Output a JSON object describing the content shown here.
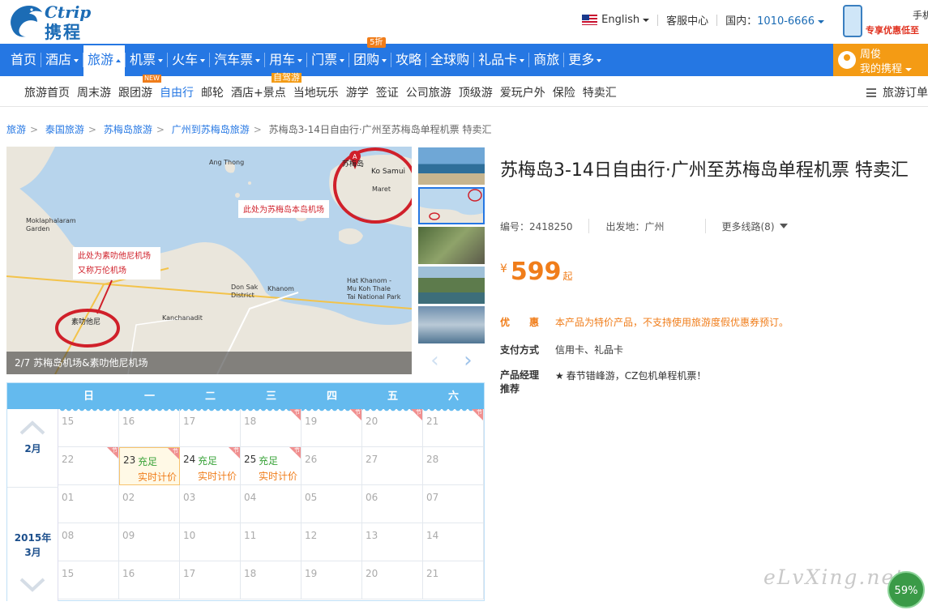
{
  "header": {
    "brand": "Ctrip",
    "brand_cn": "携程",
    "language": "English",
    "service": "客服中心",
    "phone_label": "国内：",
    "phone": "1010-6666",
    "mobile_title": "手机",
    "mobile_promo": "专享优惠低至"
  },
  "nav": {
    "items": [
      {
        "label": "首页",
        "caret": false
      },
      {
        "label": "酒店",
        "caret": true
      },
      {
        "label": "旅游",
        "caret": true,
        "active": true
      },
      {
        "label": "机票",
        "caret": true
      },
      {
        "label": "火车",
        "caret": true
      },
      {
        "label": "汽车票",
        "caret": true
      },
      {
        "label": "用车",
        "caret": true
      },
      {
        "label": "门票",
        "caret": true
      },
      {
        "label": "团购",
        "caret": true,
        "badge": "5折"
      },
      {
        "label": "攻略",
        "caret": false
      },
      {
        "label": "全球购",
        "caret": false
      },
      {
        "label": "礼品卡",
        "caret": true
      },
      {
        "label": "商旅",
        "caret": false
      },
      {
        "label": "更多",
        "caret": true
      }
    ],
    "user_name": "周俊",
    "user_menu": "我的携程"
  },
  "subnav": {
    "items": [
      "旅游首页",
      "周末游",
      "跟团游",
      "自由行",
      "邮轮",
      "酒店+景点",
      "当地玩乐",
      "游学",
      "签证",
      "公司旅游",
      "顶级游",
      "爱玩户外",
      "保险",
      "特卖汇"
    ],
    "active": "自由行",
    "new_badge": "NEW",
    "zjy_badge": "自驾游",
    "order": "旅游订单"
  },
  "breadcrumb": {
    "links": [
      "旅游",
      "泰国旅游",
      "苏梅岛旅游",
      "广州到苏梅岛旅游"
    ],
    "current": "苏梅岛3-14日自由行·广州至苏梅岛单程机票 特卖汇"
  },
  "gallery": {
    "caption": "2/7 苏梅岛机场&素叻他尼机场",
    "map_labels": {
      "samui": "苏梅岛",
      "samui_en": "Ko Samui",
      "airport_note": "此处为苏梅岛本岛机场",
      "surat_note_1": "此处为素叻他尼机场",
      "surat_note_2": "又称万伦机场",
      "surat": "素叻他尼",
      "ang_thong": "Ang Thong",
      "moklaphalaram": "Moklaphalaram",
      "garden": "Garden",
      "don_sak": "Don Sak",
      "district": "District",
      "khanom": "Khanom",
      "kanchanadit": "Kanchanadit",
      "hat_khanom": "Hat Khanom -",
      "mu_koh": "Mu Koh Thale",
      "tai_np": "Tai National Park",
      "maret": "Maret"
    },
    "prev_glyph": "‹",
    "next_glyph": "›"
  },
  "product": {
    "title": "苏梅岛3-14日自由行·广州至苏梅岛单程机票 特卖汇",
    "id_label": "编号：",
    "id": "2418250",
    "depart_label": "出发地：",
    "depart": "广州",
    "more_routes": "更多线路(8)",
    "currency": "¥",
    "price": "599",
    "price_suffix": "起",
    "discount_label": "优　　惠",
    "discount_text": "本产品为特价产品，不支持使用旅游度假优惠券预订。",
    "payment_label": "支付方式",
    "payment": "信用卡、礼品卡",
    "manager_label_1": "产品经理",
    "manager_label_2": "推荐",
    "manager_text": "春节错峰游，CZ包机单程机票！",
    "colors": {
      "accent": "#2577e3",
      "price": "#f07d1a",
      "user": "#f49b14"
    }
  },
  "calendar": {
    "weekdays": [
      "日",
      "一",
      "二",
      "三",
      "四",
      "五",
      "六"
    ],
    "months": [
      {
        "label": "2月"
      },
      {
        "label_1": "2015年",
        "label_2": "3月"
      }
    ],
    "rows": [
      [
        {
          "d": "15"
        },
        {
          "d": "16"
        },
        {
          "d": "17"
        },
        {
          "d": "18",
          "tag": true
        },
        {
          "d": "19",
          "tag": true
        },
        {
          "d": "20",
          "tag": true
        },
        {
          "d": "21",
          "tag": true
        }
      ],
      [
        {
          "d": "22",
          "tag": true
        },
        {
          "d": "23",
          "status": "充足",
          "price": "实时计价",
          "tag": true,
          "selected": true
        },
        {
          "d": "24",
          "status": "充足",
          "price": "实时计价",
          "tag": true
        },
        {
          "d": "25",
          "status": "充足",
          "price": "实时计价",
          "tag": true
        },
        {
          "d": "26"
        },
        {
          "d": "27"
        },
        {
          "d": "28"
        }
      ],
      [
        {
          "d": "01"
        },
        {
          "d": "02"
        },
        {
          "d": "03"
        },
        {
          "d": "04"
        },
        {
          "d": "05"
        },
        {
          "d": "06"
        },
        {
          "d": "07"
        }
      ],
      [
        {
          "d": "08"
        },
        {
          "d": "09"
        },
        {
          "d": "10"
        },
        {
          "d": "11"
        },
        {
          "d": "12"
        },
        {
          "d": "13"
        },
        {
          "d": "14"
        }
      ],
      [
        {
          "d": "15"
        },
        {
          "d": "16"
        },
        {
          "d": "17"
        },
        {
          "d": "18"
        },
        {
          "d": "19"
        },
        {
          "d": "20"
        },
        {
          "d": "21"
        }
      ]
    ],
    "tag_text": "节"
  },
  "watermark": "eLvXing.net",
  "scroll_progress": "59%"
}
